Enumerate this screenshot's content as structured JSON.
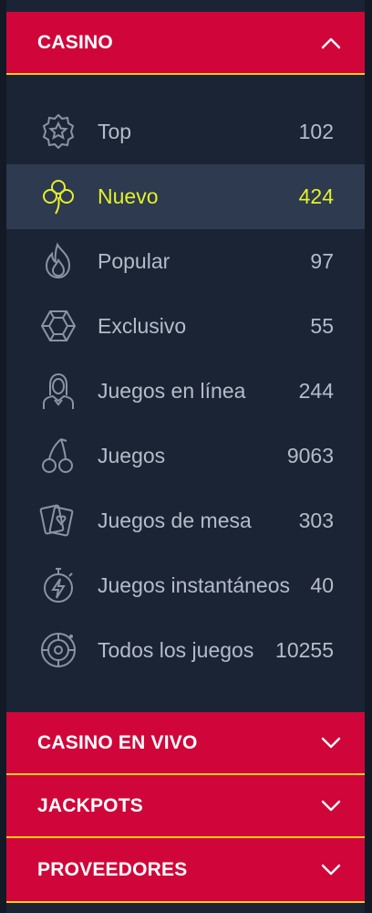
{
  "colors": {
    "header_bg": "#d0063a",
    "header_border": "#f1cd1d",
    "panel_bg": "#1b2435",
    "active_bg": "#2d3a4f",
    "text": "#b4bcc9",
    "active_text": "#e4f02a"
  },
  "casino": {
    "title": "CASINO",
    "expanded": true,
    "items": [
      {
        "label": "Top",
        "count": "102",
        "icon": "star-badge-icon"
      },
      {
        "label": "Nuevo",
        "count": "424",
        "icon": "clover-icon",
        "active": true
      },
      {
        "label": "Popular",
        "count": "97",
        "icon": "flame-icon"
      },
      {
        "label": "Exclusivo",
        "count": "55",
        "icon": "gem-icon"
      },
      {
        "label": "Juegos en línea",
        "count": "244",
        "icon": "dealer-icon"
      },
      {
        "label": "Juegos",
        "count": "9063",
        "icon": "cherry-icon"
      },
      {
        "label": "Juegos de mesa",
        "count": "303",
        "icon": "playing-cards-icon"
      },
      {
        "label": "Juegos instantáneos",
        "count": "40",
        "icon": "stopwatch-bolt-icon"
      },
      {
        "label": "Todos los juegos",
        "count": "10255",
        "icon": "roulette-icon"
      }
    ]
  },
  "sections": [
    {
      "title": "CASINO EN VIVO"
    },
    {
      "title": "JACKPOTS"
    },
    {
      "title": "PROVEEDORES"
    }
  ]
}
